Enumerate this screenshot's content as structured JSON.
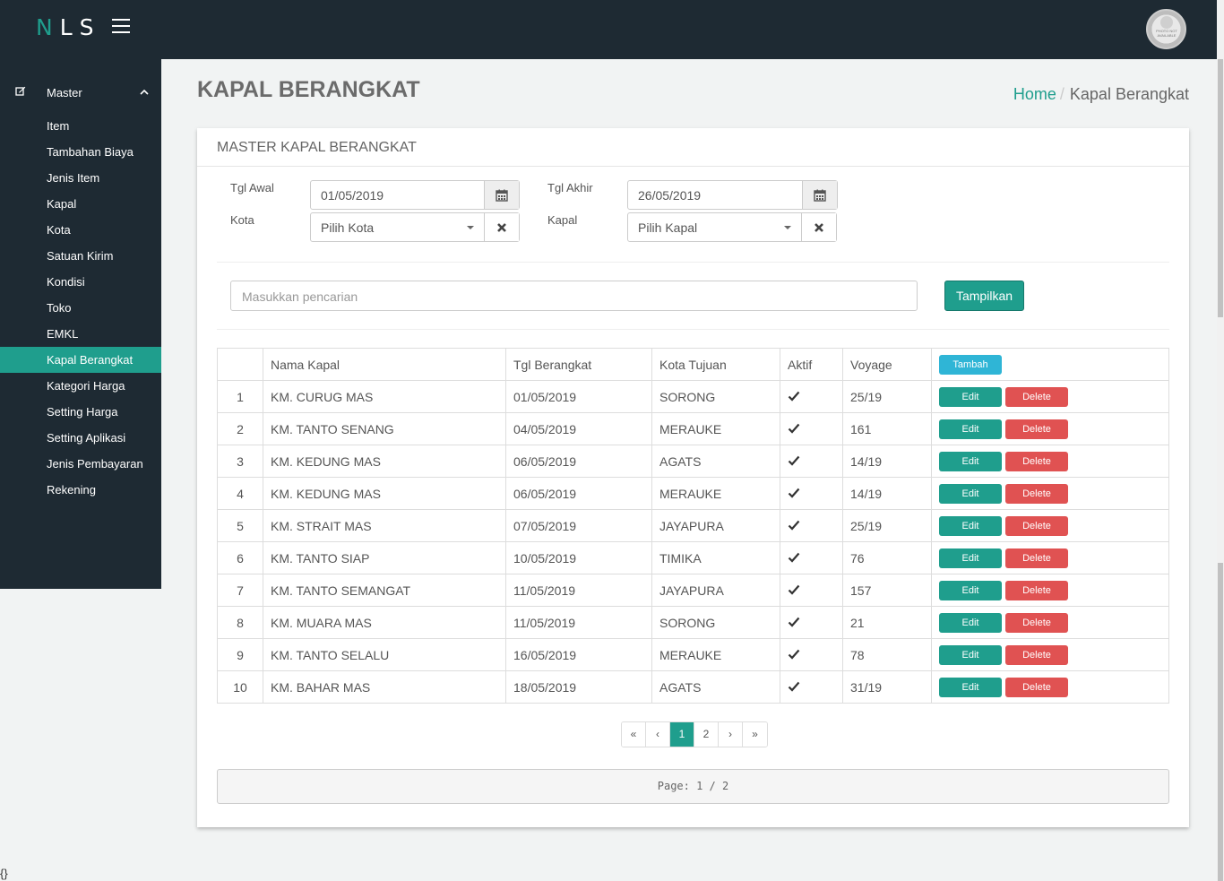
{
  "app": {
    "logo_first": "N",
    "logo_rest": "LS",
    "avatar_text": "PHOTO NOT AVAILABLE"
  },
  "sidebar": {
    "section": "Master",
    "items": [
      {
        "label": "Item"
      },
      {
        "label": "Tambahan Biaya"
      },
      {
        "label": "Jenis Item"
      },
      {
        "label": "Kapal"
      },
      {
        "label": "Kota"
      },
      {
        "label": "Satuan Kirim"
      },
      {
        "label": "Kondisi"
      },
      {
        "label": "Toko"
      },
      {
        "label": "EMKL"
      },
      {
        "label": "Kapal Berangkat",
        "active": true
      },
      {
        "label": "Kategori Harga"
      },
      {
        "label": "Setting Harga"
      },
      {
        "label": "Setting Aplikasi"
      },
      {
        "label": "Jenis Pembayaran"
      },
      {
        "label": "Rekening"
      }
    ]
  },
  "header": {
    "title": "KAPAL BERANGKAT",
    "breadcrumb_home": "Home",
    "breadcrumb_current": "Kapal Berangkat"
  },
  "panel": {
    "title": "MASTER KAPAL BERANGKAT"
  },
  "filters": {
    "tgl_awal_label": "Tgl Awal",
    "tgl_awal_value": "01/05/2019",
    "tgl_akhir_label": "Tgl Akhir",
    "tgl_akhir_value": "26/05/2019",
    "kota_label": "Kota",
    "kota_value": "Pilih Kota",
    "kapal_label": "Kapal",
    "kapal_value": "Pilih Kapal"
  },
  "search": {
    "placeholder": "Masukkan pencarian",
    "button": "Tampilkan"
  },
  "table": {
    "headers": [
      "",
      "Nama Kapal",
      "Tgl Berangkat",
      "Kota Tujuan",
      "Aktif",
      "Voyage"
    ],
    "add_button": "Tambah",
    "edit_button": "Edit",
    "delete_button": "Delete",
    "rows": [
      {
        "no": "1",
        "nama": "KM. CURUG MAS",
        "tgl": "01/05/2019",
        "kota": "SORONG",
        "voyage": "25/19"
      },
      {
        "no": "2",
        "nama": "KM. TANTO SENANG",
        "tgl": "04/05/2019",
        "kota": "MERAUKE",
        "voyage": "161"
      },
      {
        "no": "3",
        "nama": "KM. KEDUNG MAS",
        "tgl": "06/05/2019",
        "kota": "AGATS",
        "voyage": "14/19"
      },
      {
        "no": "4",
        "nama": "KM. KEDUNG MAS",
        "tgl": "06/05/2019",
        "kota": "MERAUKE",
        "voyage": "14/19"
      },
      {
        "no": "5",
        "nama": "KM. STRAIT MAS",
        "tgl": "07/05/2019",
        "kota": "JAYAPURA",
        "voyage": "25/19"
      },
      {
        "no": "6",
        "nama": "KM. TANTO SIAP",
        "tgl": "10/05/2019",
        "kota": "TIMIKA",
        "voyage": "76"
      },
      {
        "no": "7",
        "nama": "KM. TANTO SEMANGAT",
        "tgl": "11/05/2019",
        "kota": "JAYAPURA",
        "voyage": "157"
      },
      {
        "no": "8",
        "nama": "KM. MUARA MAS",
        "tgl": "11/05/2019",
        "kota": "SORONG",
        "voyage": "21"
      },
      {
        "no": "9",
        "nama": "KM. TANTO SELALU",
        "tgl": "16/05/2019",
        "kota": "MERAUKE",
        "voyage": "78"
      },
      {
        "no": "10",
        "nama": "KM. BAHAR MAS",
        "tgl": "18/05/2019",
        "kota": "AGATS",
        "voyage": "31/19"
      }
    ]
  },
  "pagination": {
    "first": "«",
    "prev": "‹",
    "pages": [
      "1",
      "2"
    ],
    "next": "›",
    "last": "»",
    "status": "Page: 1 / 2"
  },
  "footer": {
    "debug": "{}"
  }
}
